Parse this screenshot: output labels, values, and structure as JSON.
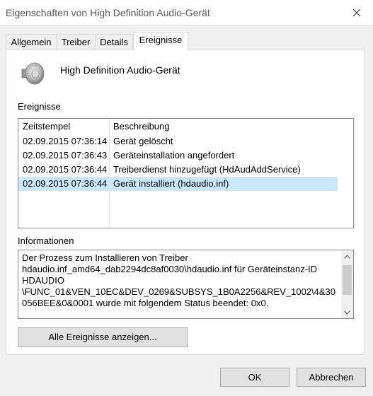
{
  "window": {
    "title": "Eigenschaften von High Definition Audio-Gerät",
    "close_icon": "close-icon"
  },
  "tabs": [
    {
      "label": "Allgemein",
      "active": false
    },
    {
      "label": "Treiber",
      "active": false
    },
    {
      "label": "Details",
      "active": false
    },
    {
      "label": "Ereignisse",
      "active": true
    }
  ],
  "device": {
    "icon": "speaker-icon",
    "name": "High Definition Audio-Gerät"
  },
  "events": {
    "label": "Ereignisse",
    "columns": [
      "Zeitstempel",
      "Beschreibung"
    ],
    "rows": [
      {
        "timestamp": "02.09.2015 07:36:14",
        "description": "Gerät gelöscht",
        "selected": false
      },
      {
        "timestamp": "02.09.2015 07:36:43",
        "description": "Geräteinstallation angefordert",
        "selected": false
      },
      {
        "timestamp": "02.09.2015 07:36:44",
        "description": "Treiberdienst hinzugefügt (HdAudAddService)",
        "selected": false
      },
      {
        "timestamp": "02.09.2015 07:36:44",
        "description": "Gerät installiert (hdaudio.inf)",
        "selected": true
      }
    ]
  },
  "information": {
    "label": "Informationen",
    "lines": [
      "Der Prozess zum Installieren von Treiber",
      "hdaudio.inf_amd64_dab2294dc8af0030\\hdaudio.inf für Geräteinstanz-ID",
      "HDAUDIO",
      "\\FUNC_01&VEN_10EC&DEV_0269&SUBSYS_1B0A2256&REV_1002\\4&30",
      "056BEE&0&0001 wurde mit folgendem Status beendet: 0x0."
    ]
  },
  "buttons": {
    "show_all": "Alle Ereignisse anzeigen...",
    "ok": "OK",
    "cancel": "Abbrechen"
  },
  "colors": {
    "selection": "#cce8ff",
    "window_bg": "#f0f0f0"
  }
}
